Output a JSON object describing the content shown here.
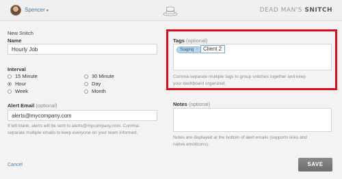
{
  "header": {
    "user_name": "Spencer",
    "user_caret": "▾",
    "brand_prefix": "DEAD MAN'S",
    "brand_suffix": "SNITCH"
  },
  "form": {
    "section_title": "New Snitch",
    "name": {
      "label": "Name",
      "value": "Hourly Job"
    },
    "interval": {
      "label": "Interval",
      "options": [
        "15 Minute",
        "30 Minute",
        "Hour",
        "Day",
        "Week",
        "Month"
      ],
      "selected": "Hour"
    },
    "alert_email": {
      "label": "Alert Email",
      "optional": "(optional)",
      "value": "alerts@mycompany.com",
      "help_line1": "If left blank, alerts will be sent to alerts@mycompany.com. Comma-",
      "help_line2": "separate multiple emails to keep everyone on your team informed."
    },
    "tags": {
      "label": "Tags",
      "optional": "(optional)",
      "items": [
        "Staging"
      ],
      "remove_glyph": "×",
      "input_value": "Client 2",
      "help_line1": "Comma-separate multiple tags to group snitches together and keep",
      "help_line2": "your dashboard organized."
    },
    "notes": {
      "label": "Notes",
      "optional": "(optional)",
      "help_line1": "Notes are displayed at the bottom of alert emails (supports links and",
      "help_line2": "native emoticons)."
    },
    "cancel_label": "Cancel",
    "save_label": "SAVE"
  },
  "colors": {
    "highlight": "#e00b14",
    "link": "#4a7aa8",
    "save_button": "#777777"
  },
  "icons": {
    "hat": "hat-icon",
    "avatar": "avatar"
  }
}
